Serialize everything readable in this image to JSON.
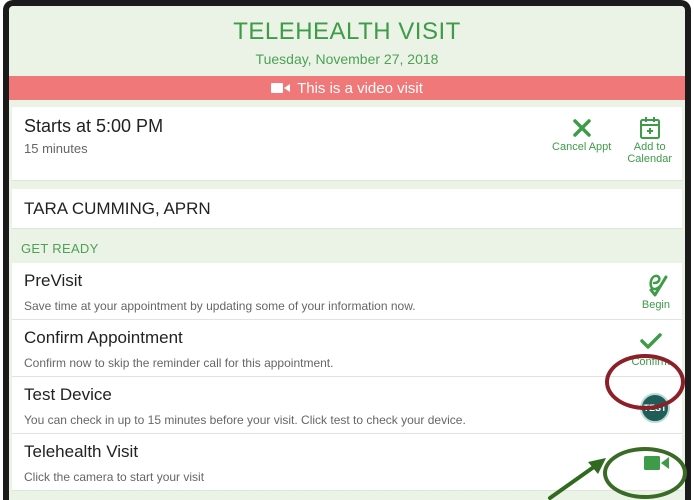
{
  "header": {
    "title": "TELEHEALTH VISIT",
    "date": "Tuesday, November 27, 2018"
  },
  "banner": {
    "text": "This is a video visit",
    "icon": "video-camera-icon"
  },
  "appointment": {
    "starts": "Starts at 5:00 PM",
    "duration": "15 minutes",
    "actions": [
      {
        "label": "Cancel Appt",
        "icon": "close-x-icon"
      },
      {
        "label": "Add to Calendar",
        "label_line1": "Add to",
        "label_line2": "Calendar",
        "icon": "calendar-add-icon"
      }
    ]
  },
  "provider": {
    "name": "TARA CUMMING, APRN"
  },
  "get_ready": {
    "label": "GET READY"
  },
  "tasks": [
    {
      "title": "PreVisit",
      "desc": "Save time at your appointment by updating some of your information now.",
      "action": "Begin",
      "icon": "evisit-icon"
    },
    {
      "title": "Confirm Appointment",
      "desc": "Confirm now to skip the reminder call for this appointment.",
      "action": "Confirm",
      "icon": "checkmark-icon"
    },
    {
      "title": "Test Device",
      "desc": "You can check in up to 15 minutes before your visit.  Click test to check your device.",
      "action": "TEST",
      "icon": "test-badge-icon"
    },
    {
      "title": "Telehealth Visit",
      "desc": "Click the camera to start your visit",
      "action": "",
      "icon": "video-camera-icon"
    }
  ],
  "colors": {
    "accent_green": "#3e9b48",
    "banner_red": "#f07878",
    "highlight_red": "#8b2028",
    "highlight_green": "#3a6b26",
    "background": "#eaf3e6"
  }
}
